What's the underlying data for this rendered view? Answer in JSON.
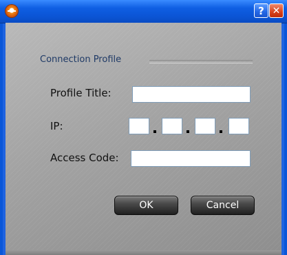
{
  "window": {
    "help_button": "?",
    "close_button": "✕"
  },
  "group": {
    "title": "Connection Profile"
  },
  "form": {
    "profile_title_label": "Profile Title:",
    "profile_title_value": "",
    "ip_label": "IP:",
    "ip_octets": [
      "",
      "",
      "",
      ""
    ],
    "ip_separator": ".",
    "access_code_label": "Access Code:",
    "access_code_value": ""
  },
  "buttons": {
    "ok": "OK",
    "cancel": "Cancel"
  },
  "colors": {
    "titlebar": "#0b55d6",
    "client_background": "#a3a3a3",
    "button_background": "#333333",
    "close_button": "#d7421c",
    "help_button": "#2467e5"
  }
}
